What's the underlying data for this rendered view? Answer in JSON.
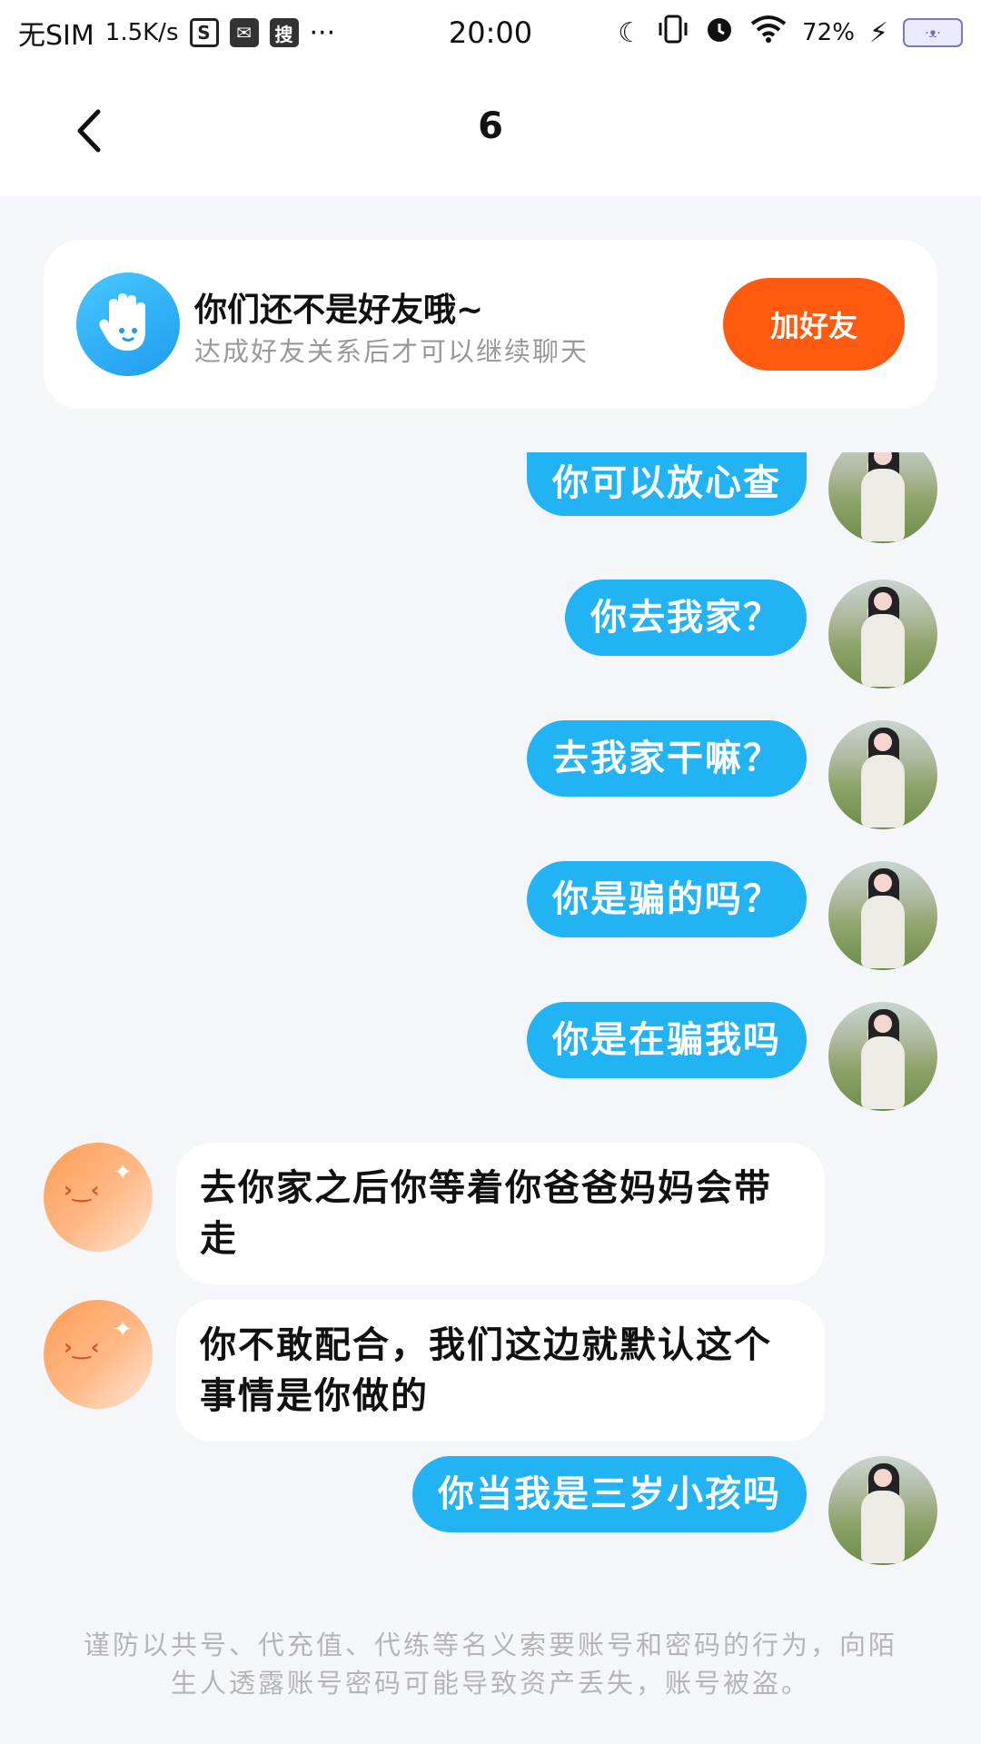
{
  "status_bar": {
    "carrier": "无SIM",
    "speed": "1.5K/s",
    "icon_s": "S",
    "icon_search": "搜",
    "more": "···",
    "time": "20:00",
    "battery_percent": "72%"
  },
  "header": {
    "title": "6"
  },
  "friend_card": {
    "title": "你们还不是好友哦~",
    "subtitle": "达成好友关系后才可以继续聊天",
    "button_label": "加好友",
    "button_color": "#ff5a0f"
  },
  "messages": [
    {
      "from": "me",
      "text": "你可以放心查"
    },
    {
      "from": "me",
      "text": "你去我家？"
    },
    {
      "from": "me",
      "text": "去我家干嘛？"
    },
    {
      "from": "me",
      "text": "你是骗的吗？"
    },
    {
      "from": "me",
      "text": "你是在骗我吗"
    },
    {
      "from": "other",
      "text": "去你家之后你等着你爸爸妈妈会带走"
    },
    {
      "from": "other",
      "text": "你不敢配合，我们这边就默认这个事情是你做的"
    },
    {
      "from": "me",
      "text": "你当我是三岁小孩吗"
    }
  ],
  "footer": {
    "warning": "谨防以共号、代充值、代练等名义索要账号和密码的行为，向陌生人透露账号密码可能导致资产丢失，账号被盗。"
  },
  "colors": {
    "my_bubble": "#22b3f5",
    "their_bubble": "#ffffff",
    "background": "#f5f6fa"
  }
}
